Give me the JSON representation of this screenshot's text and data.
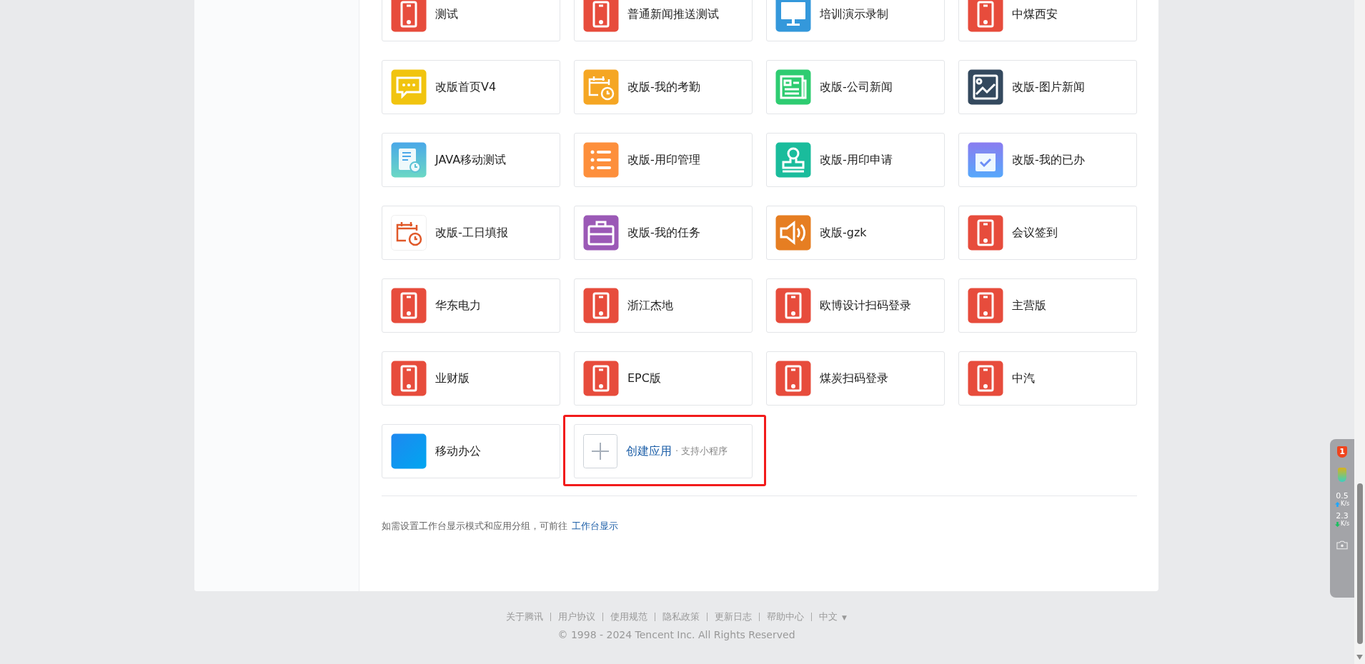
{
  "apps": [
    {
      "label": "测试",
      "kind": "phone"
    },
    {
      "label": "普通新闻推送测试",
      "kind": "phone"
    },
    {
      "label": "培训演示录制",
      "kind": "monitor"
    },
    {
      "label": "中煤西安",
      "kind": "phone"
    },
    {
      "label": "改版首页V4",
      "kind": "chat"
    },
    {
      "label": "改版-我的考勤",
      "kind": "calendar"
    },
    {
      "label": "改版-公司新闻",
      "kind": "news"
    },
    {
      "label": "改版-图片新闻",
      "kind": "image"
    },
    {
      "label": "JAVA移动测试",
      "kind": "document"
    },
    {
      "label": "改版-用印管理",
      "kind": "list"
    },
    {
      "label": "改版-用印申请",
      "kind": "stamp"
    },
    {
      "label": "改版-我的已办",
      "kind": "done"
    },
    {
      "label": "改版-工日填报",
      "kind": "timesheet"
    },
    {
      "label": "改版-我的任务",
      "kind": "briefcase"
    },
    {
      "label": "改版-gzk",
      "kind": "speaker"
    },
    {
      "label": "会议签到",
      "kind": "phone"
    },
    {
      "label": "华东电力",
      "kind": "phone"
    },
    {
      "label": "浙江杰地",
      "kind": "phone"
    },
    {
      "label": "欧博设计扫码登录",
      "kind": "phone"
    },
    {
      "label": "主营版",
      "kind": "phone"
    },
    {
      "label": "业财版",
      "kind": "phone"
    },
    {
      "label": "EPC版",
      "kind": "phone"
    },
    {
      "label": "煤炭扫码登录",
      "kind": "phone"
    },
    {
      "label": "中汽",
      "kind": "phone"
    },
    {
      "label": "移动办公",
      "kind": "plain"
    }
  ],
  "create_app": {
    "label": "创建应用",
    "hint": "· 支持小程序"
  },
  "hint": {
    "text": "如需设置工作台显示模式和应用分组，可前往 ",
    "link": "工作台显示"
  },
  "footer": {
    "links": [
      "关于腾讯",
      "用户协议",
      "使用规范",
      "隐私政策",
      "更新日志",
      "帮助中心"
    ],
    "language": "中文",
    "language_caret": "▼",
    "copyright": "© 1998 - 2024 Tencent Inc. All Rights Reserved"
  },
  "speed_widget": {
    "badge": "1",
    "upload": "0.5",
    "upload_unit": "K/s",
    "download": "2.3",
    "download_unit": "K/s"
  }
}
